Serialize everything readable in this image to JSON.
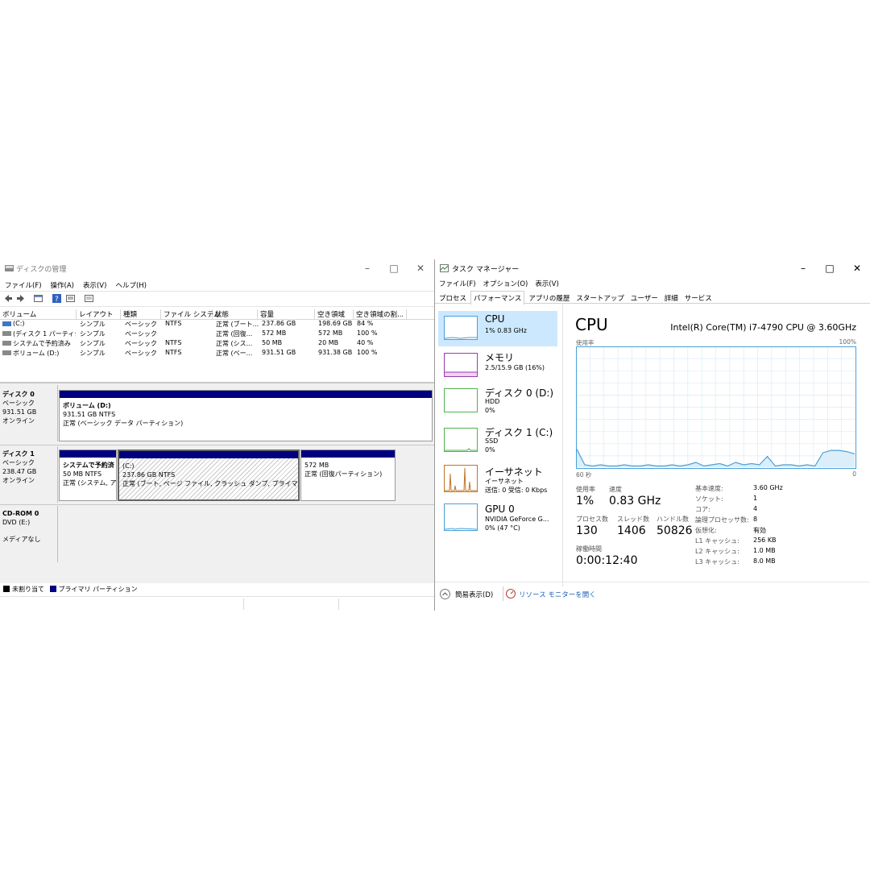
{
  "disk_mgmt": {
    "title": "ディスクの管理",
    "menu": [
      "ファイル(F)",
      "操作(A)",
      "表示(V)",
      "ヘルプ(H)"
    ],
    "columns": [
      "ボリューム",
      "レイアウト",
      "種類",
      "ファイル システム",
      "状態",
      "容量",
      "空き領域",
      "空き領域の割..."
    ],
    "volumes": [
      [
        "(C:)",
        "シンプル",
        "ベーシック",
        "NTFS",
        "正常 (ブート...",
        "237.86 GB",
        "198.69 GB",
        "84 %"
      ],
      [
        "(ディスク 1 パーティシ...",
        "シンプル",
        "ベーシック",
        "",
        "正常 (回復...",
        "572 MB",
        "572 MB",
        "100 %"
      ],
      [
        "システムで予約済み",
        "シンプル",
        "ベーシック",
        "NTFS",
        "正常 (シス...",
        "50 MB",
        "20 MB",
        "40 %"
      ],
      [
        "ボリューム (D:)",
        "シンプル",
        "ベーシック",
        "NTFS",
        "正常 (ベー...",
        "931.51 GB",
        "931.38 GB",
        "100 %"
      ]
    ],
    "disks": [
      {
        "name": "ディスク 0",
        "type": "ベーシック",
        "size": "931.51 GB",
        "status": "オンライン",
        "partitions": [
          {
            "line1": "ボリューム (D:)",
            "line2": "931.51 GB NTFS",
            "line3": "正常 (ベーシック データ パーティション)"
          }
        ]
      },
      {
        "name": "ディスク 1",
        "type": "ベーシック",
        "size": "238.47 GB",
        "status": "オンライン",
        "partitions": [
          {
            "line1": "システムで予約済",
            "line2": "50 MB NTFS",
            "line3": "正常 (システム, ア"
          },
          {
            "line1": "(C:)",
            "line2": "237.86 GB NTFS",
            "line3": "正常 (ブート, ページ ファイル, クラッシュ ダンプ, プライマリ パーティシ"
          },
          {
            "line1": "",
            "line2": "572 MB",
            "line3": "正常 (回復パーティション)"
          }
        ]
      },
      {
        "name": "CD-ROM 0",
        "type": "DVD (E:)",
        "size": "",
        "status": "メディアなし",
        "partitions": []
      }
    ],
    "legend": [
      {
        "label": "未割り当て",
        "color": "#000000"
      },
      {
        "label": "プライマリ パーティション",
        "color": "#000080"
      }
    ]
  },
  "task_mgr": {
    "title": "タスク マネージャー",
    "menu": [
      "ファイル(F)",
      "オプション(O)",
      "表示(V)"
    ],
    "tabs": [
      "プロセス",
      "パフォーマンス",
      "アプリの履歴",
      "スタートアップ",
      "ユーザー",
      "詳細",
      "サービス"
    ],
    "selected_tab": "パフォーマンス",
    "sidebar": [
      {
        "title": "CPU",
        "lines": [
          "1%  0.83 GHz"
        ],
        "color": "#4aa0d8"
      },
      {
        "title": "メモリ",
        "lines": [
          "2.5/15.9 GB (16%)"
        ],
        "color": "#9b3bb0"
      },
      {
        "title": "ディスク 0 (D:)",
        "lines": [
          "HDD",
          "0%"
        ],
        "color": "#4fb34f"
      },
      {
        "title": "ディスク 1 (C:)",
        "lines": [
          "SSD",
          "0%"
        ],
        "color": "#4fb34f"
      },
      {
        "title": "イーサネット",
        "lines": [
          "イーサネット",
          "送信: 0 受信: 0 Kbps"
        ],
        "color": "#c0752a"
      },
      {
        "title": "GPU 0",
        "lines": [
          "NVIDIA GeForce G...",
          "0% (47 °C)"
        ],
        "color": "#4aa0d8"
      }
    ],
    "cpu": {
      "heading": "CPU",
      "model": "Intel(R) Core(TM) i7-4790 CPU @ 3.60GHz",
      "graph_label": "使用率",
      "graph_max": "100%",
      "time_label": "60 秒",
      "time_end": "0",
      "usage_label": "使用率",
      "usage": "1%",
      "speed_label": "速度",
      "speed": "0.83 GHz",
      "processes_label": "プロセス数",
      "processes": "130",
      "threads_label": "スレッド数",
      "threads": "1406",
      "handles_label": "ハンドル数",
      "handles": "50826",
      "uptime_label": "稼働時間",
      "uptime": "0:00:12:40",
      "specs": [
        [
          "基本速度:",
          "3.60 GHz"
        ],
        [
          "ソケット:",
          "1"
        ],
        [
          "コア:",
          "4"
        ],
        [
          "論理プロセッサ数:",
          "8"
        ],
        [
          "仮想化:",
          "有効"
        ],
        [
          "L1 キャッシュ:",
          "256 KB"
        ],
        [
          "L2 キャッシュ:",
          "1.0 MB"
        ],
        [
          "L3 キャッシュ:",
          "8.0 MB"
        ]
      ]
    },
    "chart_data": {
      "type": "area",
      "ylim": [
        0,
        100
      ],
      "x": [
        60,
        58,
        56,
        54,
        52,
        50,
        48,
        46,
        44,
        42,
        40,
        38,
        36,
        34,
        32,
        30,
        28,
        26,
        24,
        22,
        20,
        18,
        16,
        14,
        12,
        10,
        8,
        6,
        4,
        2,
        0
      ],
      "values": [
        15,
        2,
        1,
        2,
        1,
        1,
        2,
        1,
        1,
        2,
        1,
        1,
        2,
        1,
        2,
        4,
        1,
        2,
        3,
        1,
        4,
        2,
        3,
        2,
        9,
        1,
        2,
        2,
        1,
        2,
        1,
        12,
        14,
        14,
        13,
        11
      ]
    },
    "footer_left": "簡易表示(D)",
    "footer_right": "リソース モニターを開く"
  }
}
